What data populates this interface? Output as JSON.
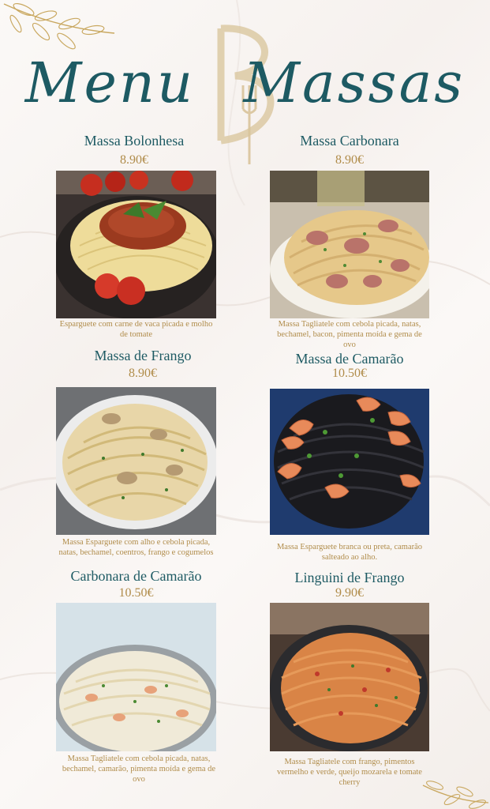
{
  "header": {
    "title_left": "Menu",
    "title_right": "Massas"
  },
  "items": [
    {
      "name": "Massa Bolonhesa",
      "price": "8.90€",
      "description": "Esparguete com carne de vaca picada e molho de tomate",
      "image": "bolognese-photo"
    },
    {
      "name": "Massa Carbonara",
      "price": "8.90€",
      "description": "Massa Tagliatele com cebola picada, natas, bechamel, bacon, pimenta moída e gema de ovo",
      "image": "carbonara-photo"
    },
    {
      "name": "Massa de Frango",
      "price": "8.90€",
      "description": "Massa Esparguete com alho e cebola picada, natas, bechamel, coentros, frango e cogumelos",
      "image": "chicken-pasta-photo"
    },
    {
      "name": "Massa de Camarão",
      "price": "10.50€",
      "description": "Massa Esparguete branca ou preta, camarão salteado ao alho.",
      "image": "shrimp-pasta-photo"
    },
    {
      "name": "Carbonara de Camarão",
      "price": "10.50€",
      "description": "Massa Tagliatele com cebola picada, natas, bechamel, camarão, pimenta moída e gema de ovo",
      "image": "shrimp-carbonara-photo"
    },
    {
      "name": "Linguini de Frango",
      "price": "9.90€",
      "description": "Massa Tagliatele com frango, pimentos vermelho e verde, queijo mozarela e tomate cherry",
      "image": "chicken-linguini-photo"
    }
  ],
  "colors": {
    "title": "#1d5a63",
    "accent": "#b08c4a",
    "background": "#fbf9f7"
  }
}
